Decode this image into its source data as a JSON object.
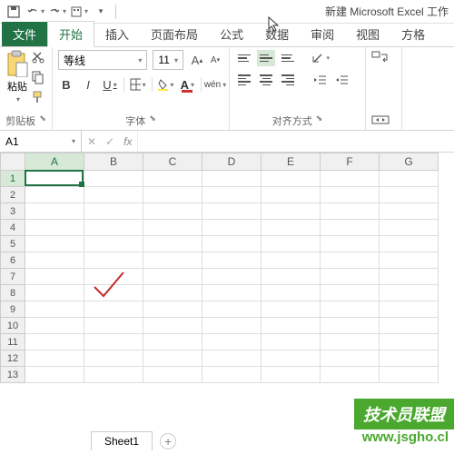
{
  "app_title": "新建 Microsoft Excel 工作",
  "qat": {
    "save": "保存",
    "undo": "撤销",
    "redo": "恢复"
  },
  "tabs": {
    "file": "文件",
    "home": "开始",
    "insert": "插入",
    "pagelayout": "页面布局",
    "formulas": "公式",
    "data": "数据",
    "review": "审阅",
    "view": "视图",
    "square": "方格"
  },
  "ribbon": {
    "clipboard": {
      "paste": "粘贴",
      "label": "剪贴板"
    },
    "font": {
      "name": "等线",
      "size": "11",
      "bold": "B",
      "italic": "I",
      "underline": "U",
      "phonetic": "wén",
      "label": "字体"
    },
    "alignment": {
      "label": "对齐方式"
    }
  },
  "namebox": {
    "ref": "A1"
  },
  "formula_bar": {
    "fx": "fx"
  },
  "columns": [
    "A",
    "B",
    "C",
    "D",
    "E",
    "F",
    "G"
  ],
  "rows": [
    "1",
    "2",
    "3",
    "4",
    "5",
    "6",
    "7",
    "8",
    "9",
    "10",
    "11",
    "12",
    "13"
  ],
  "sheet": {
    "name": "Sheet1",
    "add": "+"
  },
  "watermark": {
    "badge": "技术员联盟",
    "url": "www.jsgho.cl"
  }
}
